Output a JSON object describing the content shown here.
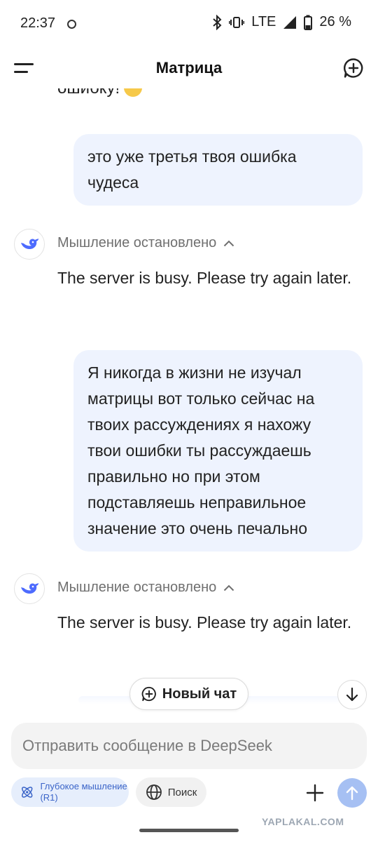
{
  "status_bar": {
    "time": "22:37",
    "network": "LTE",
    "battery": "26 %",
    "icons": [
      "bluetooth-icon",
      "vibrate-icon",
      "signal-icon",
      "battery-icon"
    ]
  },
  "header": {
    "title": "Матрица",
    "menu_icon": "menu-icon",
    "new_chat_icon": "new-chat-icon"
  },
  "messages": [
    {
      "role": "assistant-tail",
      "text": "ошибку!"
    },
    {
      "role": "user",
      "text": "это уже третья твоя ошибка чудеса"
    },
    {
      "role": "assistant",
      "thinking_label": "Мышление остановлено",
      "text": "The server is busy. Please try again later."
    },
    {
      "role": "user",
      "text": "Я никогда в жизни не изучал матрицы вот только сейчас на твоих рассуждениях я нахожу твои ошибки ты рассуждаешь правильно но при этом подставляешь неправильное значение это очень печально"
    },
    {
      "role": "assistant",
      "thinking_label": "Мышление остановлено",
      "text": "The server is busy. Please try again later."
    }
  ],
  "floating": {
    "new_chat_label": "Новый чат"
  },
  "composer": {
    "placeholder": "Отправить сообщение в DeepSeek",
    "deep_think_label": "Глубокое мышление (R1)",
    "search_label": "Поиск"
  },
  "watermark": "YAPLAKAL.COM",
  "colors": {
    "accent": "#4d6bfe",
    "user_bubble": "#eef3fe",
    "send_button": "#a6c0f3"
  }
}
